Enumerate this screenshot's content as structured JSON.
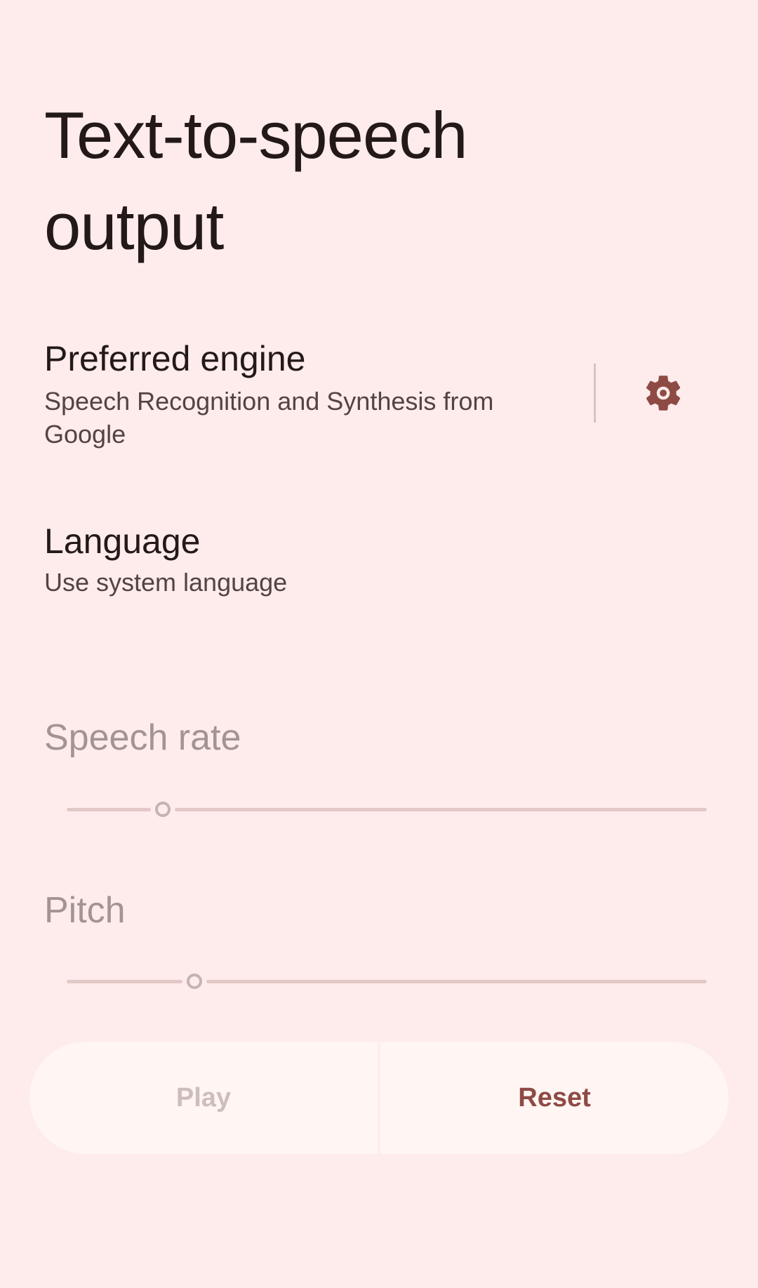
{
  "title": "Text-to-speech output",
  "preferred_engine": {
    "title": "Preferred engine",
    "summary": "Speech Recognition and Synthesis from Google",
    "settings_icon": "gear-icon"
  },
  "language": {
    "title": "Language",
    "summary": "Use system language"
  },
  "speech_rate": {
    "label": "Speech rate",
    "value_fraction": 0.15,
    "enabled": false
  },
  "pitch": {
    "label": "Pitch",
    "value_fraction": 0.2,
    "enabled": false
  },
  "buttons": {
    "play": "Play",
    "reset": "Reset"
  },
  "colors": {
    "background": "#fdeceb",
    "accent": "#8e4a44",
    "disabled_text": "#a39493",
    "button_surface": "#fff5f3"
  }
}
